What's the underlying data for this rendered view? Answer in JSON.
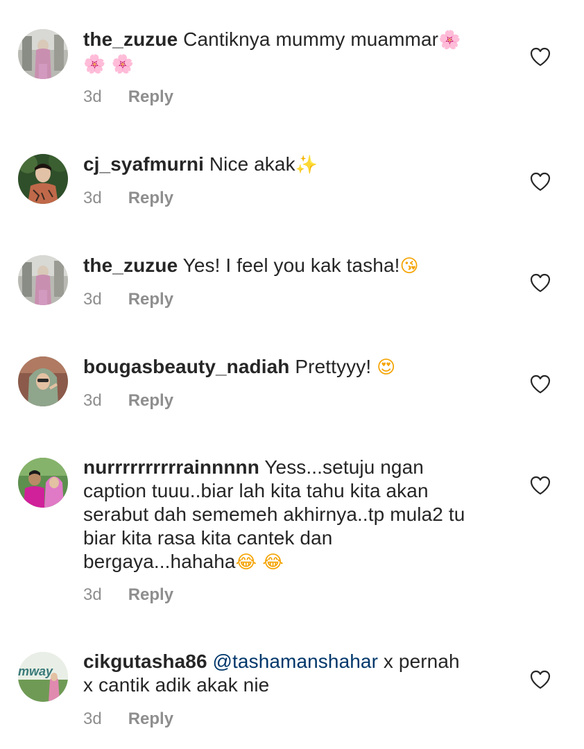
{
  "comments": [
    {
      "username": "the_zuzue",
      "text": "Cantiknya mummy muammar",
      "emoji_inline": "🌸",
      "emoji_line2": "🌸 🌸",
      "time": "3d",
      "reply_label": "Reply"
    },
    {
      "username": "cj_syafmurni",
      "text": "Nice akak",
      "emoji": "✨",
      "time": "3d",
      "reply_label": "Reply"
    },
    {
      "username": "the_zuzue",
      "text": "Yes! I feel you kak tasha!",
      "emoji": "😘",
      "time": "3d",
      "reply_label": "Reply"
    },
    {
      "username": "bougasbeauty_nadiah",
      "text": "Prettyyy!",
      "emoji": "😍",
      "time": "3d",
      "reply_label": "Reply"
    },
    {
      "username": "nurrrrrrrrrrainnnnn",
      "line1": "Yess...setuju ngan",
      "line2": "caption tuuu..biar lah kita tahu kita akan",
      "line3": "serabut dah sememeh akhirnya..tp mula2 tu",
      "line4": "biar kita rasa kita cantek dan",
      "line5": "bergaya...hahaha",
      "emoji": "😂 😂",
      "time": "3d",
      "reply_label": "Reply"
    },
    {
      "username": "cikgutasha86",
      "mention": "@tashamanshahar",
      "line1": "x pernah",
      "line2": "x cantik adik akak nie",
      "avatar_text": "mway",
      "time": "3d",
      "reply_label": "Reply"
    }
  ],
  "icons": {
    "like": "heart-outline-icon"
  },
  "colors": {
    "text": "#262626",
    "meta": "#8e8e8e",
    "mention": "#00376b"
  }
}
